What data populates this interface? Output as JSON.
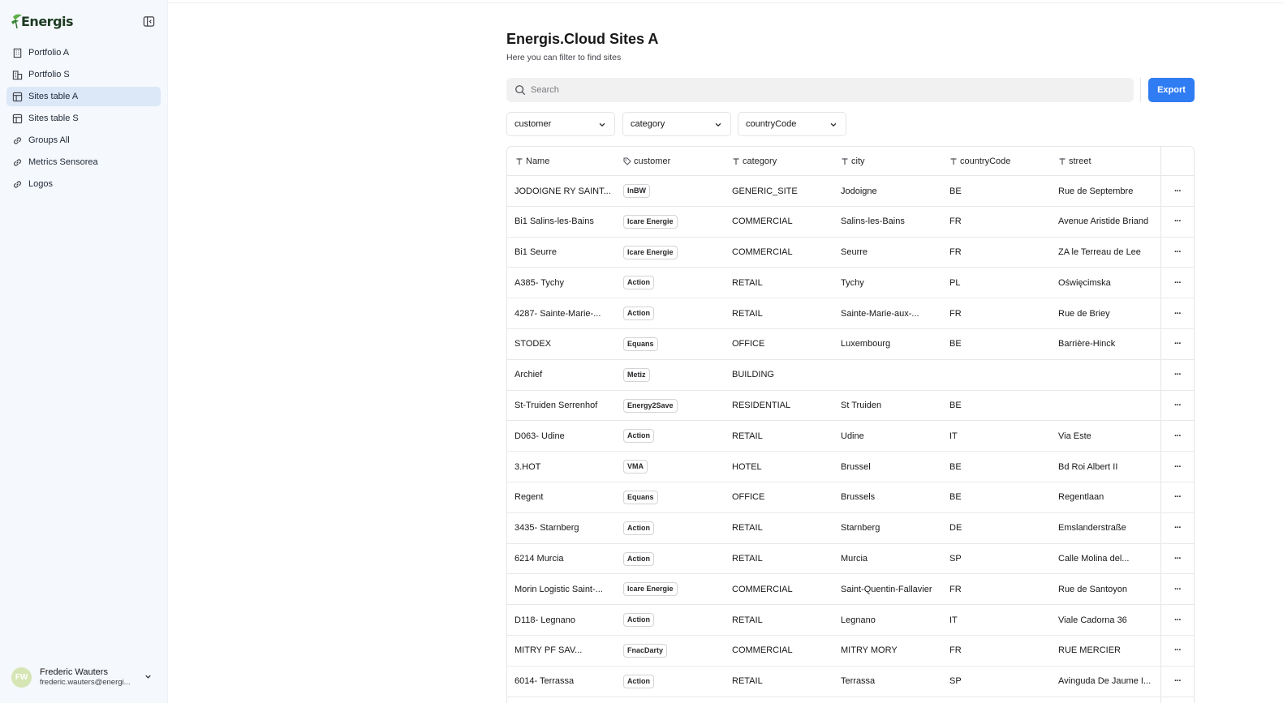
{
  "app": {
    "logo_text": "Energis"
  },
  "sidebar": {
    "items": [
      {
        "label": "Portfolio A",
        "icon": "building-icon",
        "active": false
      },
      {
        "label": "Portfolio S",
        "icon": "buildings-icon",
        "active": false
      },
      {
        "label": "Sites table A",
        "icon": "table-icon",
        "active": true
      },
      {
        "label": "Sites table S",
        "icon": "table-icon",
        "active": false
      },
      {
        "label": "Groups All",
        "icon": "link-icon",
        "active": false
      },
      {
        "label": "Metrics Sensorea",
        "icon": "link-icon",
        "active": false
      },
      {
        "label": "Logos",
        "icon": "link-icon",
        "active": false
      }
    ],
    "user": {
      "initials": "FW",
      "name": "Frederic Wauters",
      "email": "frederic.wauters@energi..."
    }
  },
  "page": {
    "title": "Energis.Cloud Sites A",
    "subtitle": "Here you can filter to find sites",
    "search_placeholder": "Search",
    "export_label": "Export",
    "filters": [
      "customer",
      "category",
      "countryCode"
    ]
  },
  "table": {
    "columns": [
      "Name",
      "customer",
      "category",
      "city",
      "countryCode",
      "street"
    ],
    "rows": [
      {
        "name": "JODOIGNE RY SAINT...",
        "customer": "InBW",
        "category": "GENERIC_SITE",
        "city": "Jodoigne",
        "country": "BE",
        "street": "Rue de Septembre"
      },
      {
        "name": "Bi1 Salins-les-Bains",
        "customer": "Icare Energie",
        "category": "COMMERCIAL",
        "city": "Salins-les-Bains",
        "country": "FR",
        "street": "Avenue Aristide Briand"
      },
      {
        "name": "Bi1 Seurre",
        "customer": "Icare Energie",
        "category": "COMMERCIAL",
        "city": "Seurre",
        "country": "FR",
        "street": "ZA le Terreau de Lee"
      },
      {
        "name": "A385- Tychy",
        "customer": "Action",
        "category": "RETAIL",
        "city": "Tychy",
        "country": "PL",
        "street": "Oświęcimska"
      },
      {
        "name": "4287- Sainte-Marie-...",
        "customer": "Action",
        "category": "RETAIL",
        "city": "Sainte-Marie-aux-...",
        "country": "FR",
        "street": "Rue de Briey"
      },
      {
        "name": "STODEX",
        "customer": "Equans",
        "category": "OFFICE",
        "city": "Luxembourg",
        "country": "BE",
        "street": "Barrière-Hinck"
      },
      {
        "name": "Archief",
        "customer": "Metiz",
        "category": "BUILDING",
        "city": "",
        "country": "",
        "street": ""
      },
      {
        "name": "St-Truiden Serrenhof",
        "customer": "Energy2Save",
        "category": "RESIDENTIAL",
        "city": "St Truiden",
        "country": "BE",
        "street": ""
      },
      {
        "name": "D063- Udine",
        "customer": "Action",
        "category": "RETAIL",
        "city": "Udine",
        "country": "IT",
        "street": "Via Este"
      },
      {
        "name": "3.HOT",
        "customer": "VMA",
        "category": "HOTEL",
        "city": "Brussel",
        "country": "BE",
        "street": "Bd Roi Albert II"
      },
      {
        "name": "Regent",
        "customer": "Equans",
        "category": "OFFICE",
        "city": "Brussels",
        "country": "BE",
        "street": "Regentlaan"
      },
      {
        "name": "3435- Starnberg",
        "customer": "Action",
        "category": "RETAIL",
        "city": "Starnberg",
        "country": "DE",
        "street": "Emslanderstraße"
      },
      {
        "name": "6214 Murcia",
        "customer": "Action",
        "category": "RETAIL",
        "city": "Murcia",
        "country": "SP",
        "street": "Calle Molina del..."
      },
      {
        "name": "Morin Logistic Saint-...",
        "customer": "Icare Energie",
        "category": "COMMERCIAL",
        "city": "Saint-Quentin-Fallavier",
        "country": "FR",
        "street": "Rue de Santoyon"
      },
      {
        "name": "D118- Legnano",
        "customer": "Action",
        "category": "RETAIL",
        "city": "Legnano",
        "country": "IT",
        "street": "Viale Cadorna 36"
      },
      {
        "name": "MITRY PF SAV...",
        "customer": "FnacDarty",
        "category": "COMMERCIAL",
        "city": "MITRY MORY",
        "country": "FR",
        "street": "RUE MERCIER"
      },
      {
        "name": "6014- Terrassa",
        "customer": "Action",
        "category": "RETAIL",
        "city": "Terrassa",
        "country": "SP",
        "street": "Avinguda De Jaume I..."
      }
    ]
  }
}
